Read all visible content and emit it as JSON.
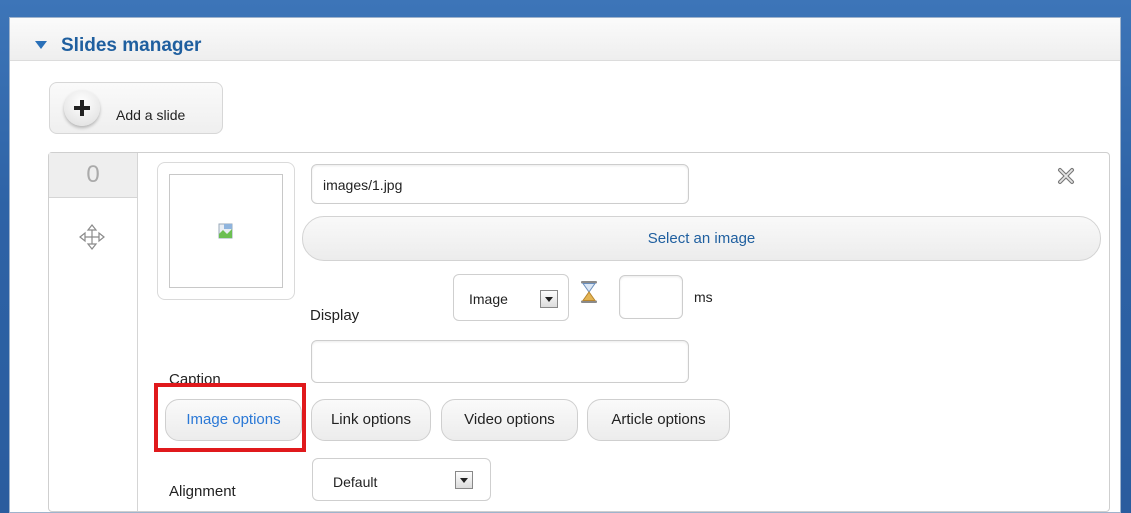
{
  "panel": {
    "title": "Slides manager"
  },
  "add_slide": {
    "label": "Add a slide"
  },
  "slide": {
    "number": "0",
    "image_path": "images/1.jpg",
    "select_image_label": "Select an image",
    "display_label": "Display",
    "display_value": "Image",
    "duration_value": "",
    "duration_unit": "ms",
    "caption_label": "Caption",
    "caption_value": "",
    "tabs": [
      {
        "label": "Image options",
        "active": true
      },
      {
        "label": "Link options",
        "active": false
      },
      {
        "label": "Video options",
        "active": false
      },
      {
        "label": "Article options",
        "active": false
      }
    ],
    "alignment_label": "Alignment",
    "alignment_value": "Default"
  },
  "colors": {
    "background": "#2e63a6",
    "title": "#1f5f9f",
    "active_tab": "#2a78d6",
    "highlight": "#e0191c"
  },
  "icons": [
    "triangle-down-icon",
    "plus-icon",
    "move-icon",
    "broken-image-icon",
    "close-icon",
    "hourglass-icon",
    "dropdown-arrow-icon"
  ]
}
